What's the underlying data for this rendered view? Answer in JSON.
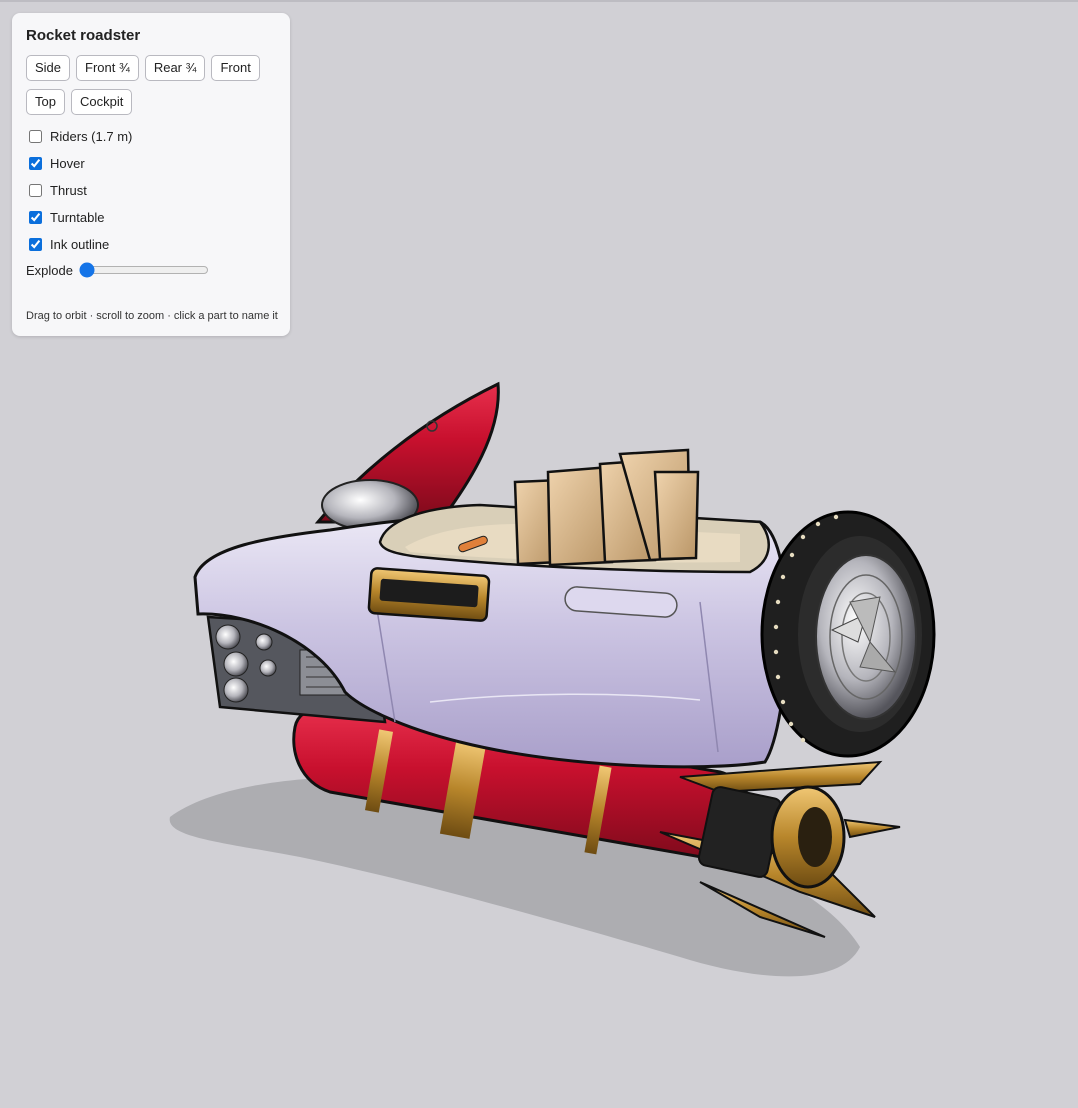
{
  "panel": {
    "title": "Rocket roadster",
    "view_buttons": [
      "Side",
      "Front ¾",
      "Rear ¾",
      "Front",
      "Top",
      "Cockpit"
    ],
    "options": [
      {
        "label": "Riders (1.7 m)",
        "checked": false
      },
      {
        "label": "Hover",
        "checked": true
      },
      {
        "label": "Thrust",
        "checked": false
      },
      {
        "label": "Turntable",
        "checked": true
      },
      {
        "label": "Ink outline",
        "checked": true
      }
    ],
    "explode_label": "Explode",
    "explode_value": 0,
    "hint": "Drag to orbit · scroll to zoom · click a part to name it"
  },
  "colors": {
    "background": "#d1d0d5",
    "body": "#c9c3df",
    "rocket_red": "#c8102e",
    "brass": "#b8862b",
    "seat_tan": "#d9b98f",
    "tire": "#1f1f1f",
    "accent": "#0b6fdc"
  }
}
